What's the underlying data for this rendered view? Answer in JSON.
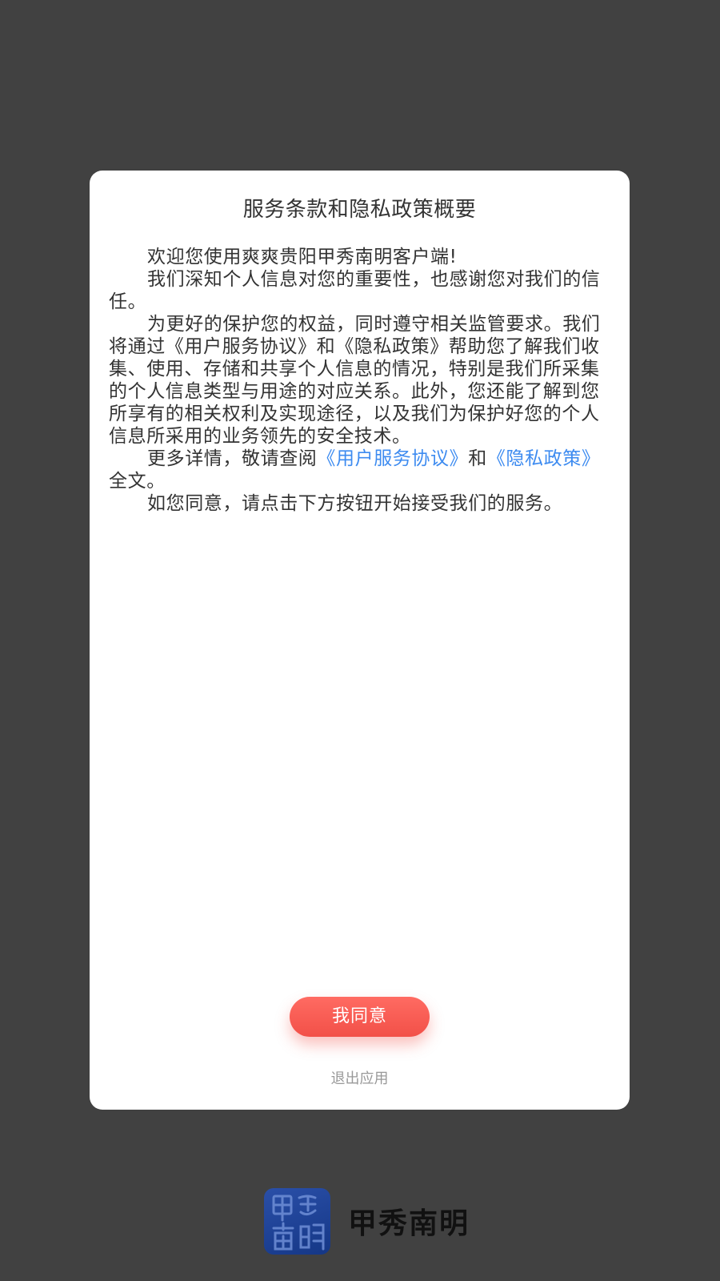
{
  "dialog": {
    "title": "服务条款和隐私政策概要",
    "paragraphs": {
      "p1": "欢迎您使用爽爽贵阳甲秀南明客户端!",
      "p2": "我们深知个人信息对您的重要性，也感谢您对我们的信任。",
      "p3": "为更好的保护您的权益，同时遵守相关监管要求。我们将通过《用户服务协议》和《隐私政策》帮助您了解我们收集、使用、存储和共享个人信息的情况，特别是我们所采集的个人信息类型与用途的对应关系。此外，您还能了解到您所享有的相关权利及实现途径，以及我们为保护好您的个人信息所采用的业务领先的安全技术。",
      "p4_prefix": "更多详情，敬请查阅",
      "p4_link1": "《用户服务协议》",
      "p4_middle": "和",
      "p4_link2": "《隐私政策》",
      "p4_suffix": "全文。",
      "p5": "如您同意，请点击下方按钮开始接受我们的服务。"
    },
    "agree_button": "我同意",
    "exit_link": "退出应用"
  },
  "brand": {
    "logo_text": "甲秀南明",
    "name": "甲秀南明",
    "logo_color": "#1f43a0"
  },
  "colors": {
    "overlay": "#414141",
    "accent": "#f25048",
    "link": "#3d8bf0"
  },
  "icons": {
    "brand_logo": "brand-logo-icon"
  }
}
